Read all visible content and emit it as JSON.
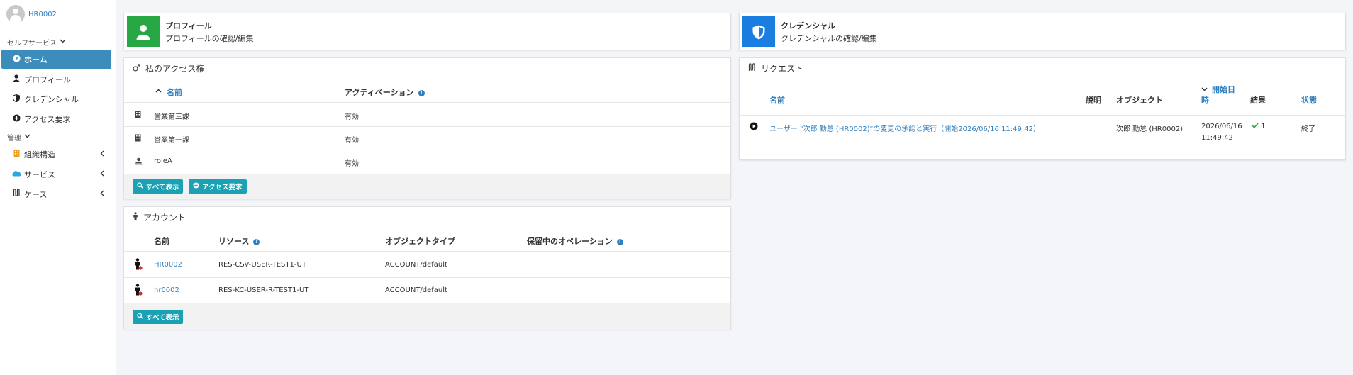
{
  "user": {
    "name": "HR0002"
  },
  "sidebar": {
    "selfservice_header": "セルフサービス",
    "items": [
      {
        "label": "ホーム",
        "icon": "dashboard-icon"
      },
      {
        "label": "プロフィール",
        "icon": "user-icon"
      },
      {
        "label": "クレデンシャル",
        "icon": "shield-icon"
      },
      {
        "label": "アクセス要求",
        "icon": "plus-circle-icon"
      }
    ],
    "admin_header": "管理",
    "admin_items": [
      {
        "label": "組織構造",
        "icon": "building-icon"
      },
      {
        "label": "サービス",
        "icon": "cloud-icon"
      },
      {
        "label": "ケース",
        "icon": "case-icon"
      }
    ]
  },
  "tiles": {
    "profile": {
      "title": "プロフィール",
      "subtitle": "プロフィールの確認/編集",
      "color": "#27a844"
    },
    "credentials": {
      "title": "クレデンシャル",
      "subtitle": "クレデンシャルの確認/編集",
      "color": "#1a7de0"
    }
  },
  "access": {
    "title": "私のアクセス権",
    "col_name": "名前",
    "col_activation": "アクティベーション",
    "rows": [
      {
        "name": "営業第三課",
        "activation": "有効"
      },
      {
        "name": "営業第一課",
        "activation": "有効"
      },
      {
        "name": "roleA",
        "activation": "有効"
      }
    ],
    "btn_show_all": "すべて表示",
    "btn_request": "アクセス要求"
  },
  "accounts": {
    "title": "アカウント",
    "col_name": "名前",
    "col_resource": "リソース",
    "col_objtype": "オブジェクトタイプ",
    "col_pending": "保留中のオペレーション",
    "rows": [
      {
        "name": "HR0002",
        "resource": "RES-CSV-USER-TEST1-UT",
        "objtype": "ACCOUNT/default"
      },
      {
        "name": "hr0002",
        "resource": "RES-KC-USER-R-TEST1-UT",
        "objtype": "ACCOUNT/default"
      }
    ],
    "btn_show_all": "すべて表示"
  },
  "requests": {
    "title": "リクエスト",
    "col_name": "名前",
    "col_desc": "説明",
    "col_object": "オブジェクト",
    "col_start_1": "開始日",
    "col_start_2": "時",
    "col_result": "結果",
    "col_status": "状態",
    "rows": [
      {
        "name": "ユーザー \"次郎 勤怠 (HR0002)\"の変更の承認と実行（開始2026/06/16 11:49:42）",
        "object": "次郎 勤怠 (HR0002)",
        "date": "2026/06/16",
        "time": "11:49:42",
        "result": "1",
        "status": "終了"
      }
    ]
  }
}
